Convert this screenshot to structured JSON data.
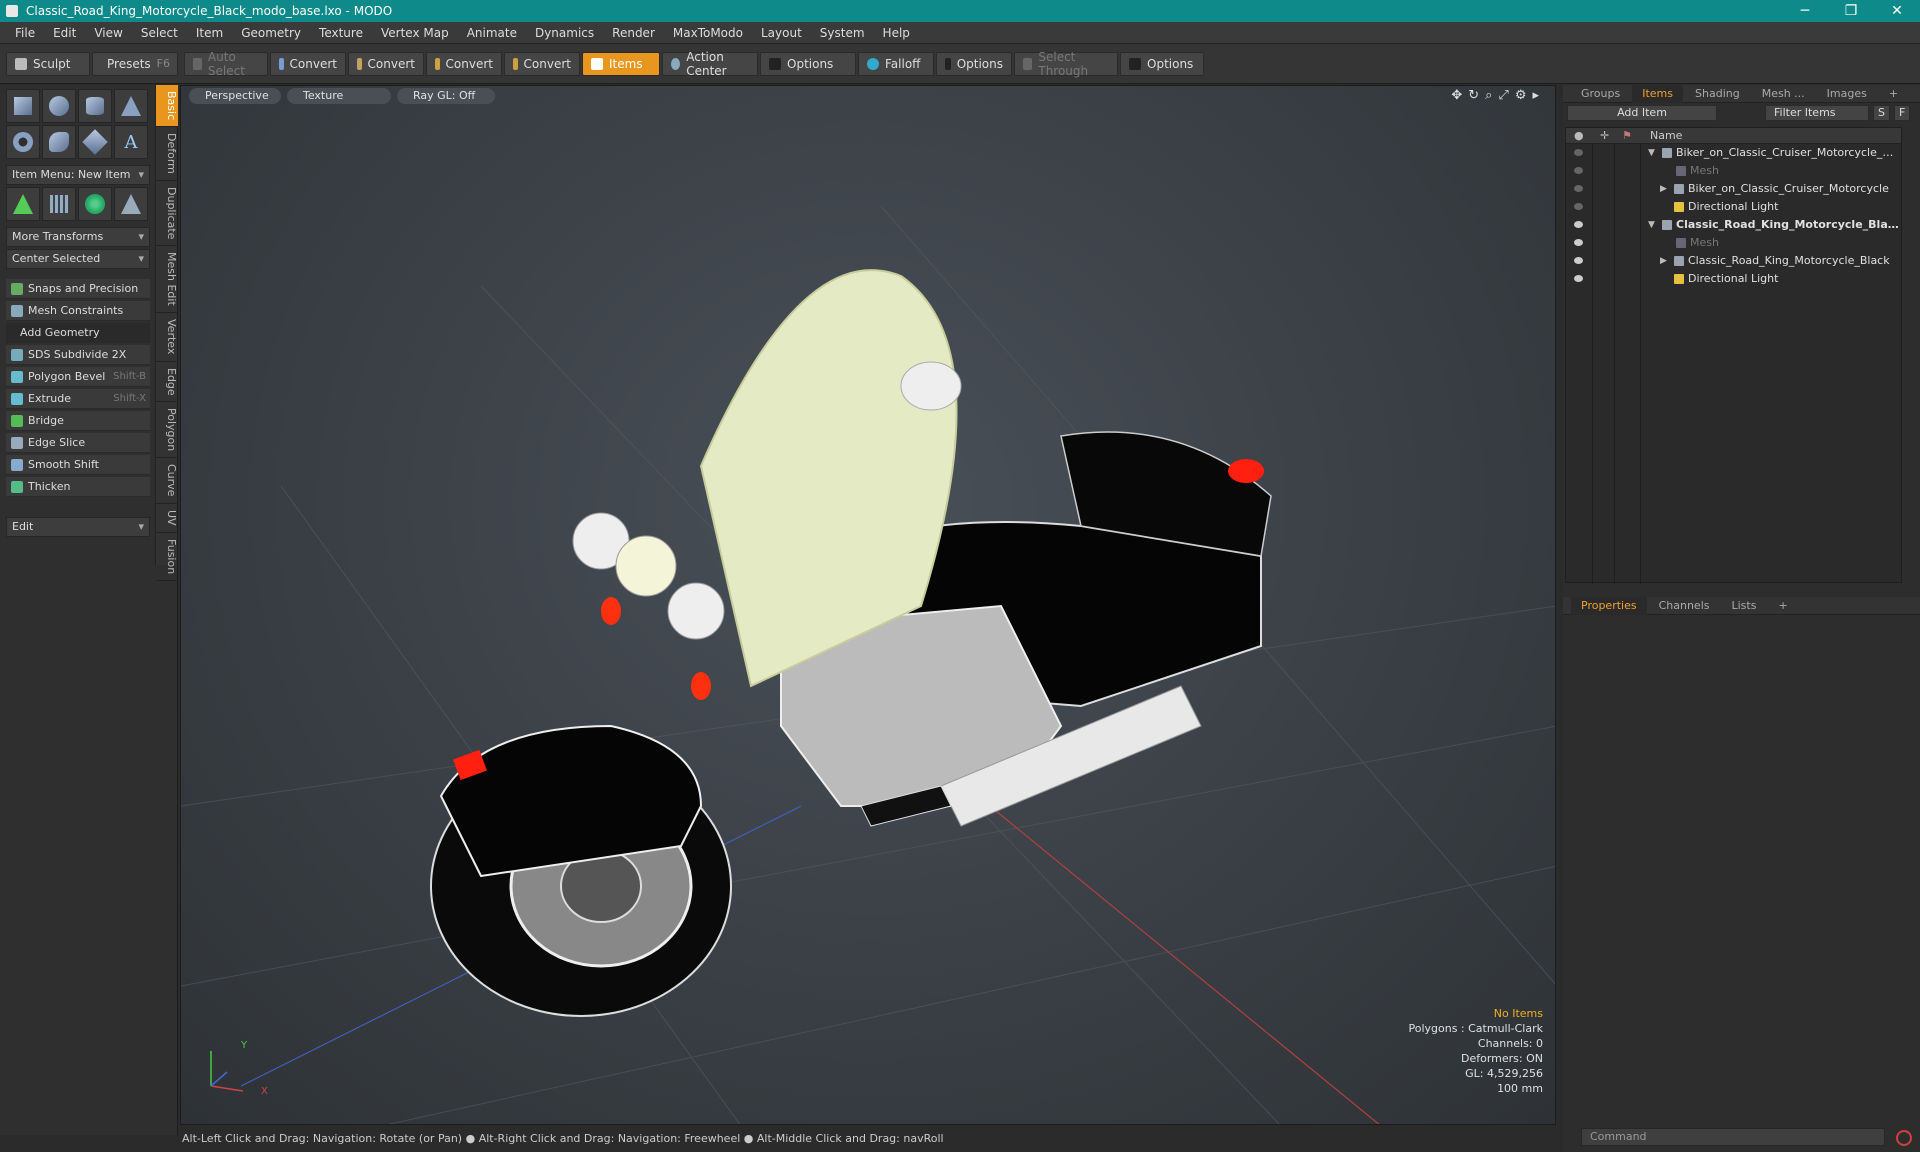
{
  "window": {
    "title": "Classic_Road_King_Motorcycle_Black_modo_base.lxo - MODO",
    "minimize": "─",
    "restore": "❐",
    "close": "✕"
  },
  "menu": [
    "File",
    "Edit",
    "View",
    "Select",
    "Item",
    "Geometry",
    "Texture",
    "Vertex Map",
    "Animate",
    "Dynamics",
    "Render",
    "MaxToModo",
    "Layout",
    "System",
    "Help"
  ],
  "toolbar": {
    "sculpt": "Sculpt",
    "presets": "Presets",
    "presets_key": "F6",
    "auto_select": "Auto Select",
    "convert1": "Convert",
    "convert2": "Convert",
    "convert3": "Convert",
    "convert4": "Convert",
    "items": "Items",
    "action_center": "Action Center",
    "options1": "Options",
    "falloff": "Falloff",
    "options2": "Options",
    "select_through": "Select Through",
    "options3": "Options"
  },
  "left_panel": {
    "vtabs": [
      "Basic",
      "Deform",
      "Duplicate",
      "Mesh Edit",
      "Vertex",
      "Edge",
      "Polygon",
      "Curve",
      "UV",
      "Fusion"
    ],
    "item_menu": "Item Menu: New Item",
    "more_transforms": "More Transforms",
    "center_selected": "Center Selected",
    "snaps": "Snaps and Precision",
    "mesh_constraints": "Mesh Constraints",
    "add_geometry": "Add Geometry",
    "tools": [
      {
        "label": "SDS Subdivide 2X",
        "key": ""
      },
      {
        "label": "Polygon Bevel",
        "key": "Shift-B"
      },
      {
        "label": "Extrude",
        "key": "Shift-X"
      },
      {
        "label": "Bridge",
        "key": ""
      },
      {
        "label": "Edge Slice",
        "key": ""
      },
      {
        "label": "Smooth Shift",
        "key": ""
      },
      {
        "label": "Thicken",
        "key": ""
      }
    ],
    "edit": "Edit"
  },
  "viewport": {
    "perspective": "Perspective",
    "texture": "Texture",
    "raygl": "Ray GL: Off",
    "axis_y": "Y",
    "axis_x": "X",
    "info": {
      "no_items": "No Items",
      "polygons": "Polygons : Catmull-Clark",
      "channels": "Channels: 0",
      "deformers": "Deformers: ON",
      "gl": "GL: 4,529,256",
      "scale": "100 mm"
    }
  },
  "status": "Alt-Left Click and Drag: Navigation: Rotate (or Pan) ● Alt-Right Click and Drag: Navigation: Freewheel ● Alt-Middle Click and Drag: navRoll",
  "right_panel": {
    "tabs": [
      "Groups",
      "Items",
      "Shading",
      "Mesh ...",
      "Images"
    ],
    "add_item": "Add Item",
    "filter_items": "Filter Items",
    "filter_s": "S",
    "filter_f": "F",
    "name_col": "Name",
    "tree": [
      {
        "label": "Biker_on_Classic_Cruiser_Motorcycle_mod ...",
        "indent": 0,
        "bold": false,
        "dim": false,
        "arrow": "▼"
      },
      {
        "label": "Mesh",
        "indent": 1,
        "bold": false,
        "dim": true,
        "arrow": ""
      },
      {
        "label": "Biker_on_Classic_Cruiser_Motorcycle",
        "indent": 1,
        "bold": false,
        "dim": false,
        "arrow": "▶"
      },
      {
        "label": "Directional Light",
        "indent": 1,
        "bold": false,
        "dim": false,
        "arrow": ""
      },
      {
        "label": "Classic_Road_King_Motorcycle_Blac...",
        "indent": 0,
        "bold": true,
        "dim": false,
        "arrow": "▼"
      },
      {
        "label": "Mesh",
        "indent": 1,
        "bold": false,
        "dim": true,
        "arrow": ""
      },
      {
        "label": "Classic_Road_King_Motorcycle_Black",
        "indent": 1,
        "bold": false,
        "dim": false,
        "arrow": "▶"
      },
      {
        "label": "Directional Light",
        "indent": 1,
        "bold": false,
        "dim": false,
        "arrow": ""
      }
    ],
    "prop_tabs": [
      "Properties",
      "Channels",
      "Lists"
    ],
    "command": "Command"
  }
}
